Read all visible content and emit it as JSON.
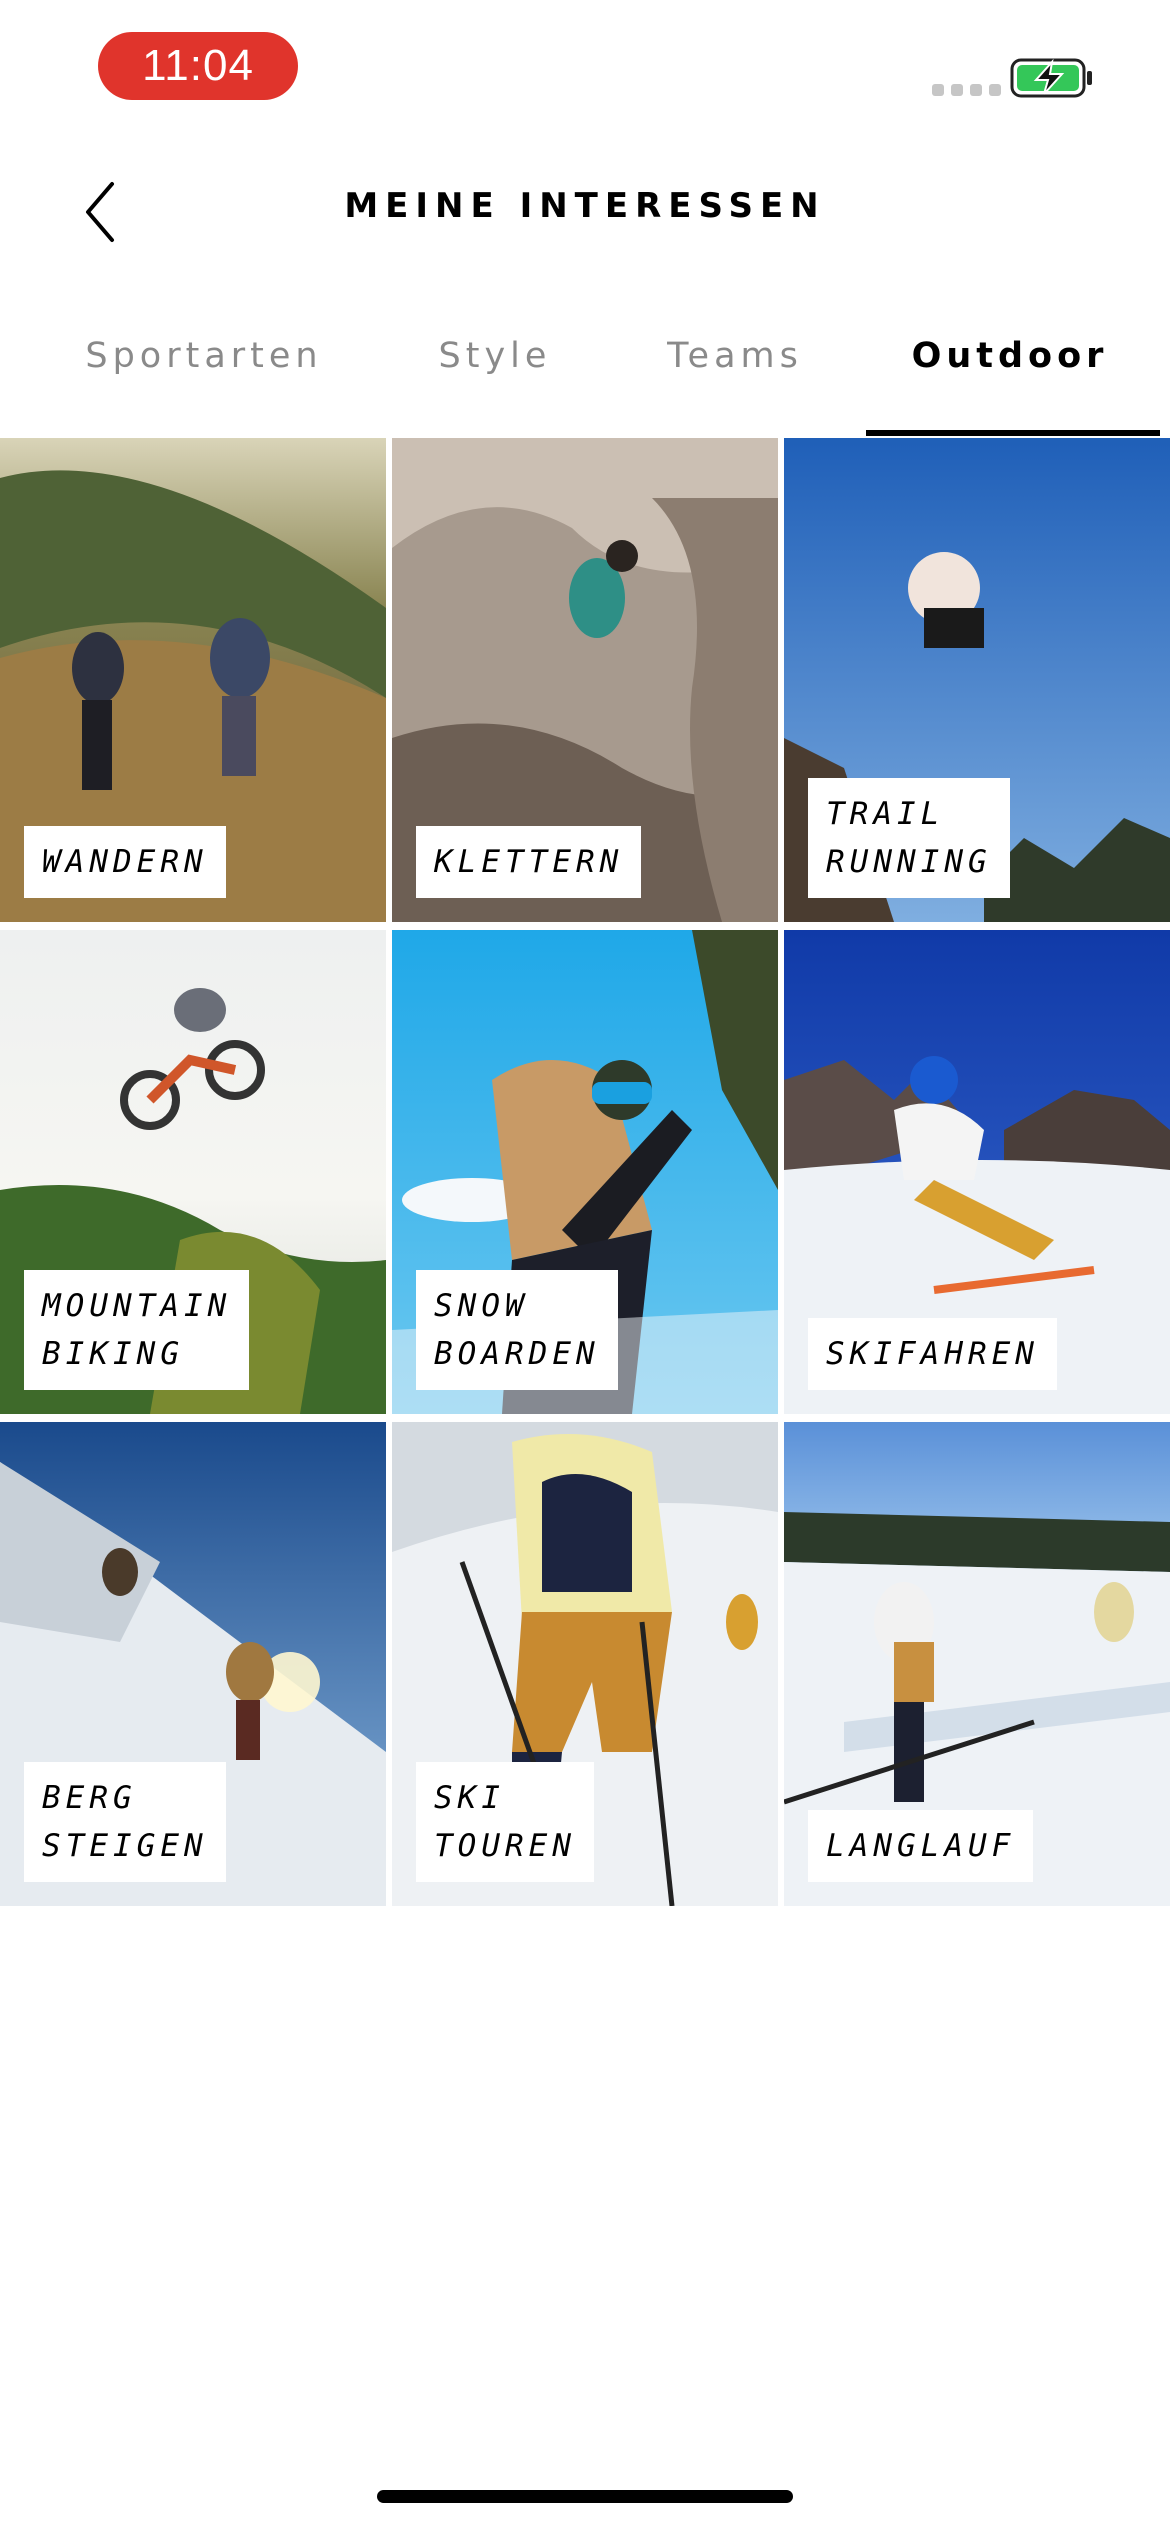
{
  "status_bar": {
    "time": "11:04",
    "battery_color": "#34c759"
  },
  "header": {
    "title": "MEINE INTERESSEN"
  },
  "tabs": [
    {
      "label": "Sportarten",
      "active": false
    },
    {
      "label": "Style",
      "active": false
    },
    {
      "label": "Teams",
      "active": false
    },
    {
      "label": "Outdoor",
      "active": true
    }
  ],
  "tiles": [
    {
      "label": "WANDERN"
    },
    {
      "label": "KLETTERN"
    },
    {
      "label": "TRAIL\nRUNNING"
    },
    {
      "label": "MOUNTAIN\nBIKING"
    },
    {
      "label": "SNOW\nBOARDEN"
    },
    {
      "label": "SKIFAHREN"
    },
    {
      "label": "BERG\nSTEIGEN"
    },
    {
      "label": "SKI\nTOUREN"
    },
    {
      "label": "LANGLAUF"
    }
  ]
}
